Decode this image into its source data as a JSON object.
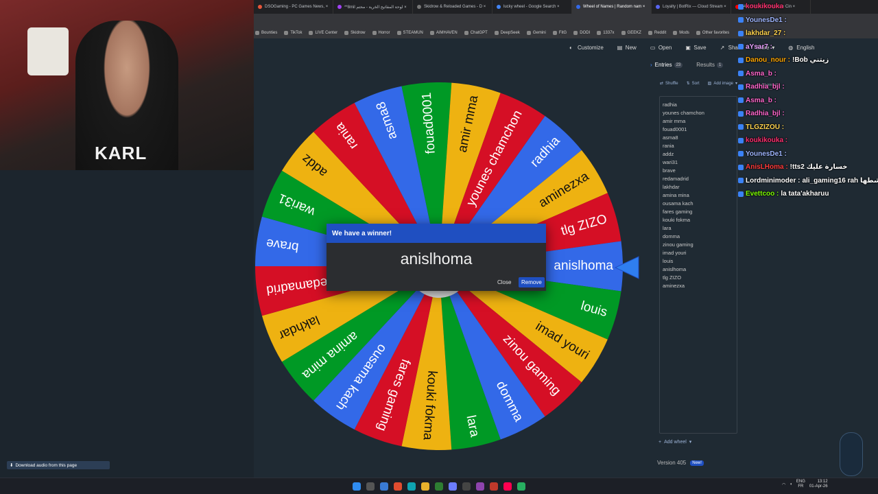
{
  "browser": {
    "tabs": [
      {
        "label": "DSOGaming - PC Games News, ×",
        "color": "#e8563a"
      },
      {
        "label": "**8mil لوحة المفاتيح الخرية - محتم ×",
        "color": "#a142f4"
      },
      {
        "label": "Skidrow & Reloaded Games - D ×",
        "color": "#777777"
      },
      {
        "label": "lucky wheel - Google Search ×",
        "color": "#4285f4"
      },
      {
        "label": "Wheel of Names | Random nam ×",
        "color": "#3369e8",
        "active": true
      },
      {
        "label": "Loyalty | BotRix — Cloud Stream ×",
        "color": "#5865f2"
      },
      {
        "label": "(40) Tension Suspense Cin ×",
        "color": "#ff0000"
      }
    ],
    "bookmarks": [
      "Bounties",
      "TikTok",
      "LIVE Center",
      "Skidrow",
      "Horror",
      "STEAMUN",
      "AIMHAVEN",
      "ChatGPT",
      "DeepSeek",
      "Gemini",
      "FitG",
      "DODI",
      "1337x",
      "GEEKZ",
      "Reddit",
      "Mods",
      "Other favorites"
    ]
  },
  "webcam": {
    "shirt_text": "KARL"
  },
  "topmenu": {
    "customize": "Customize",
    "new": "New",
    "open": "Open",
    "save": "Save",
    "share": "Share",
    "gallery": "Gallery",
    "more": "More",
    "language": "English"
  },
  "wheel": {
    "segments": [
      "radhia",
      "aminezxa",
      "tlg ZIZO",
      "anislhoma",
      "louis",
      "imad youri",
      "zinou gaming",
      "domma",
      "lara",
      "kouki fokma",
      "fares gaming",
      "ousama kach",
      "amina mina",
      "lakhdar",
      "redamadrid",
      "brave",
      "wari31",
      "addz",
      "rania",
      "asma8",
      "fouad0001",
      "amir mma",
      "younes chamchon"
    ],
    "colors": [
      "#3369e8",
      "#eeb211",
      "#d50f25",
      "#3369e8",
      "#009925",
      "#eeb211",
      "#d50f25",
      "#3369e8",
      "#009925",
      "#eeb211",
      "#d50f25",
      "#3369e8",
      "#009925",
      "#eeb211",
      "#d50f25",
      "#3369e8",
      "#009925",
      "#eeb211",
      "#d50f25",
      "#3369e8",
      "#009925",
      "#eeb211",
      "#d50f25"
    ]
  },
  "dialog": {
    "title": "We have a winner!",
    "winner": "anislhoma",
    "close_label": "Close",
    "remove_label": "Remove"
  },
  "panel": {
    "entries_label": "Entries",
    "entries_count": "23",
    "results_label": "Results",
    "results_count": "1",
    "shuffle_label": "Shuffle",
    "sort_label": "Sort",
    "add_image_label": "Add image",
    "advanced_label": "Advanced",
    "entries": [
      "radhia",
      "younes chamchon",
      "amir mma",
      "fouad0001",
      "asma8",
      "rania",
      "addz",
      "wari31",
      "brave",
      "redamadrid",
      "lakhdar",
      "amina mina",
      "ousama kach",
      "fares gaming",
      "kouki fokma",
      "lara",
      "domma",
      "zinou gaming",
      "imad youri",
      "louis",
      "anislhoma",
      "tlg ZIZO",
      "aminezxa"
    ],
    "add_wheel_label": "Add wheel",
    "version_label": "Version 405",
    "new_label": "New!"
  },
  "chat": [
    {
      "user": "koukikouka",
      "msg": "",
      "color": "#ff2e6e"
    },
    {
      "user": "YounesDe1 :",
      "msg": "",
      "color": "#9fb6ff"
    },
    {
      "user": "lakhdar_27 :",
      "msg": "",
      "color": "#ffd34d"
    },
    {
      "user": "aYsar7 :",
      "msg": "",
      "color": "#e9a0ff"
    },
    {
      "user": "Danou_nour :",
      "msg": "!Bob زيتني",
      "color": "#ffa500"
    },
    {
      "user": "Asma_b :",
      "msg": "",
      "color": "#ff66cc"
    },
    {
      "user": "Radhia_bjl :",
      "msg": "",
      "color": "#ff66cc"
    },
    {
      "user": "Asma_b :",
      "msg": "",
      "color": "#ff66cc"
    },
    {
      "user": "Radhia_bjl :",
      "msg": "",
      "color": "#ff66cc"
    },
    {
      "user": "TLGZIZOU :",
      "msg": "",
      "color": "#ffd34d"
    },
    {
      "user": "koukikouka :",
      "msg": "",
      "color": "#ff2e6e"
    },
    {
      "user": "YounesDe1 :",
      "msg": "",
      "color": "#9fb6ff"
    },
    {
      "user": "AnisLHoma :",
      "msg": "!tts2 خسارة عليك",
      "color": "#ff3b3b"
    },
    {
      "user": "Lordminimoder :",
      "msg": "ali_gaming16 rah شطها",
      "color": "#ffffff"
    },
    {
      "user": "Evettcoo :",
      "msg": "la tata'akharuu",
      "color": "#7CFC00"
    }
  ],
  "download_bar": {
    "label": "Download audio from this page"
  },
  "tray": {
    "lang": "ENG",
    "region": "FR",
    "time": "13:12",
    "date": "01-Apr-26"
  }
}
